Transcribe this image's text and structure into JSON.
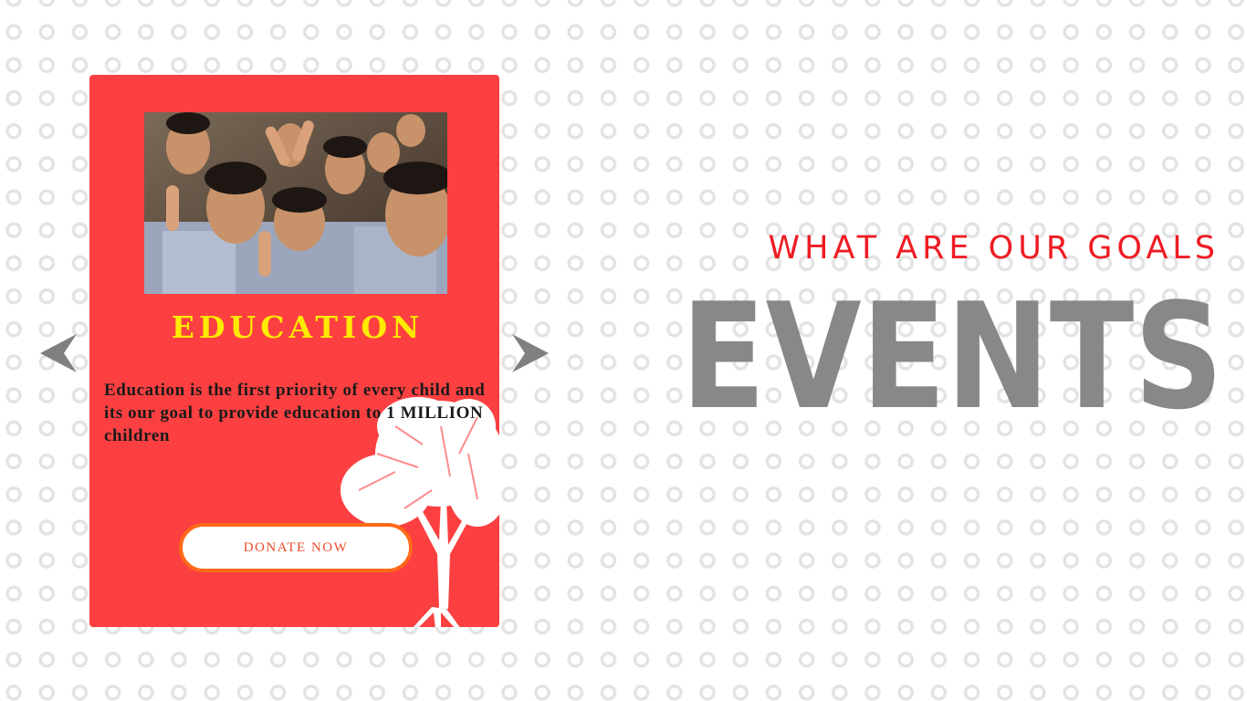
{
  "carousel": {
    "prev_icon": "arrow-left-icon",
    "next_icon": "arrow-right-icon",
    "arrow_color": "#808080"
  },
  "card": {
    "background_color": "#fc4041",
    "image": "children-group-photo",
    "decoration_icon": "tree-icon",
    "title": "EDUCATION",
    "title_color": "#ffea00",
    "description": "Education is the first priority of every child and its our goal to provide education to 1 MILLION  children",
    "donate_label": "DONATE NOW",
    "donate_border_color": "#ff6a1a"
  },
  "section": {
    "kicker": "WHAT ARE OUR GOALS",
    "kicker_color": "#ee1c24",
    "title": "EVENTS",
    "title_color": "#888888"
  }
}
